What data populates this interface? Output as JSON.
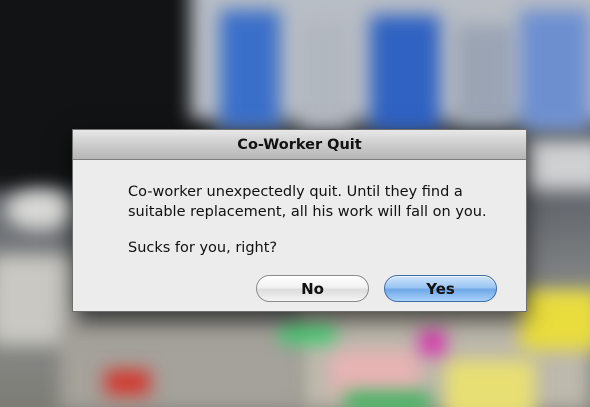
{
  "dialog": {
    "title": "Co-Worker Quit",
    "message_line1": "Co-worker unexpectedly quit. Until they find a",
    "message_line2": "suitable replacement, all his work will fall on you.",
    "message_sub": "Sucks for you, right?",
    "no_label": "No",
    "yes_label": "Yes"
  },
  "colors": {
    "default_button": "#8fbef0",
    "dialog_bg": "#ececec"
  }
}
